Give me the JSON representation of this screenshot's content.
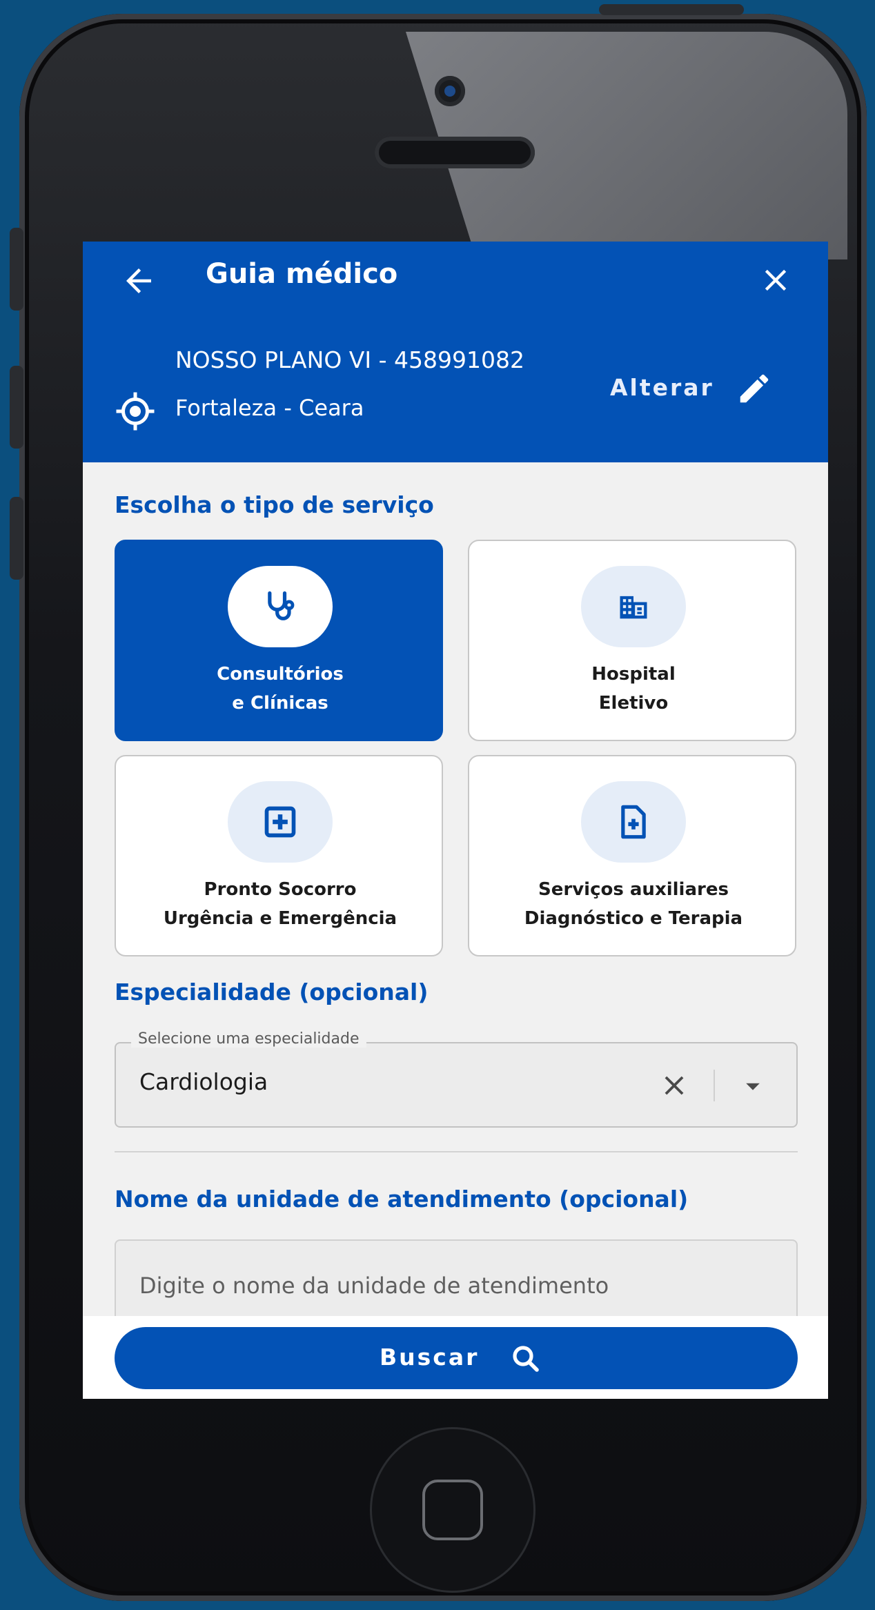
{
  "header": {
    "title": "Guia médico",
    "plan": "NOSSO PLANO VI - 458991082",
    "location": "Fortaleza - Ceara",
    "change_label": "Alterar"
  },
  "service_type": {
    "heading": "Escolha o tipo de serviço",
    "cards": [
      {
        "line1": "Consultórios",
        "line2": "e Clínicas",
        "icon": "stethoscope-icon",
        "selected": true
      },
      {
        "line1": "Hospital",
        "line2": "Eletivo",
        "icon": "hospital-building-icon",
        "selected": false
      },
      {
        "line1": "Pronto Socorro",
        "line2": "Urgência e Emergência",
        "icon": "medical-cross-icon",
        "selected": false
      },
      {
        "line1": "Serviços auxiliares",
        "line2": "Diagnóstico e Terapia",
        "icon": "medical-file-icon",
        "selected": false
      }
    ]
  },
  "specialty": {
    "heading": "Especialidade (opcional)",
    "field_label": "Selecione uma especialidade",
    "value": "Cardiologia"
  },
  "unit_name": {
    "heading": "Nome da unidade de atendimento (opcional)",
    "placeholder": "Digite o nome da unidade de atendimento"
  },
  "search_button": {
    "label": "Buscar",
    "icon": "search-icon"
  },
  "colors": {
    "primary": "#0352b5",
    "background": "#f1f1f1",
    "outer_background": "#0b4f7e"
  }
}
